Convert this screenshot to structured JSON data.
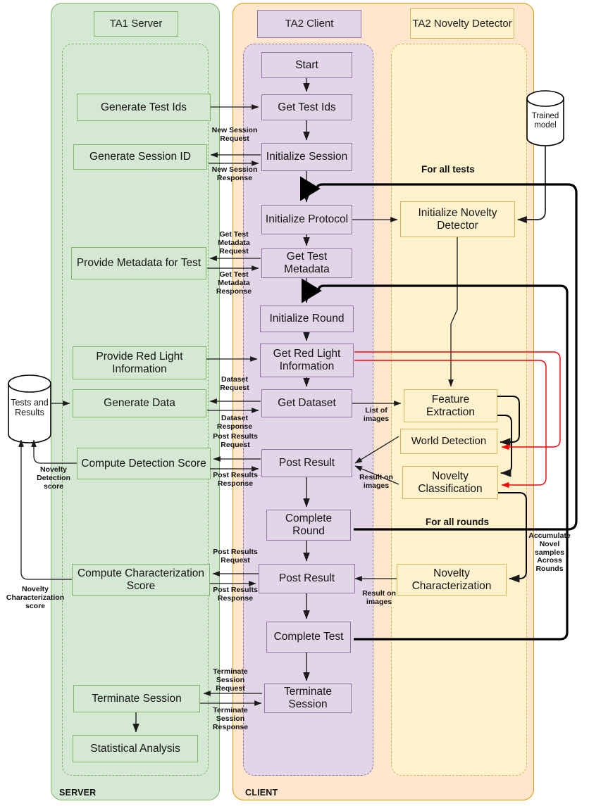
{
  "lanes": [
    {
      "id": "server",
      "title": "TA1 Server",
      "footer": "SERVER",
      "fill": "#d5e8d4",
      "stroke": "#82b366",
      "inner_stroke": "#82b366"
    },
    {
      "id": "client",
      "title": "TA2 Client",
      "footer": "CLIENT",
      "fill": "#ffe6cc",
      "stroke": "#d79b00",
      "inner_stroke": "#9673a6",
      "inner_fill": "#e1d5e7"
    },
    {
      "id": "detector",
      "title": "TA2 Novelty Detector",
      "footer": "",
      "fill": "#ffe6cc",
      "stroke": "#d79b00",
      "inner_stroke": "#d6b656",
      "inner_fill": "#fff2cc"
    }
  ],
  "server_nodes": [
    {
      "id": "generate-test-ids",
      "label": "Generate Test Ids"
    },
    {
      "id": "generate-session-id",
      "label": "Generate Session ID"
    },
    {
      "id": "provide-metadata-for-test",
      "label": "Provide Metadata for Test"
    },
    {
      "id": "provide-red-light-information",
      "label": "Provide Red Light Information"
    },
    {
      "id": "generate-data",
      "label": "Generate Data"
    },
    {
      "id": "compute-detection-score",
      "label": "Compute Detection Score"
    },
    {
      "id": "compute-characterization-score",
      "label": "Compute Characterization Score"
    },
    {
      "id": "terminate-session",
      "label": "Terminate Session"
    },
    {
      "id": "statistical-analysis",
      "label": "Statistical Analysis"
    }
  ],
  "client_nodes": [
    {
      "id": "start",
      "label": "Start"
    },
    {
      "id": "get-test-ids",
      "label": "Get Test Ids"
    },
    {
      "id": "initialize-session",
      "label": "Initialize Session"
    },
    {
      "id": "initialize-protocol",
      "label": "Initialize Protocol"
    },
    {
      "id": "get-test-metadata",
      "label": "Get Test Metadata"
    },
    {
      "id": "initialize-round",
      "label": "Initialize Round"
    },
    {
      "id": "get-red-light-information",
      "label": "Get Red Light Information"
    },
    {
      "id": "get-dataset",
      "label": "Get Dataset"
    },
    {
      "id": "post-result-detection",
      "label": "Post Result"
    },
    {
      "id": "complete-round",
      "label": "Complete Round"
    },
    {
      "id": "post-result-characterization",
      "label": "Post Result"
    },
    {
      "id": "complete-test",
      "label": "Complete Test"
    },
    {
      "id": "terminate-session-client",
      "label": "Terminate Session"
    }
  ],
  "detector_nodes": [
    {
      "id": "initialize-novelty-detector",
      "label": "Initialize Novelty Detector"
    },
    {
      "id": "feature-extraction",
      "label": "Feature Extraction"
    },
    {
      "id": "world-detection",
      "label": "World Detection"
    },
    {
      "id": "novelty-classification",
      "label": "Novelty Classification"
    },
    {
      "id": "novelty-characterization",
      "label": "Novelty Characterization"
    }
  ],
  "datastores": [
    {
      "id": "tests-and-results",
      "label": "Tests and Results"
    },
    {
      "id": "trained-model",
      "label": "Trained model"
    }
  ],
  "edge_labels": [
    {
      "id": "new-session-request",
      "text": "New Session Request"
    },
    {
      "id": "new-session-response",
      "text": "New Session Response"
    },
    {
      "id": "get-test-metadata-request",
      "text": "Get Test Metadata Request"
    },
    {
      "id": "get-test-metadata-response",
      "text": "Get Test Metadata Response"
    },
    {
      "id": "dataset-request",
      "text": "Dataset Request"
    },
    {
      "id": "dataset-response",
      "text": "Dataset Response"
    },
    {
      "id": "post-results-request-1",
      "text": "Post Results Request"
    },
    {
      "id": "post-results-response-1",
      "text": "Post Results Response"
    },
    {
      "id": "post-results-request-2",
      "text": "Post Results Request"
    },
    {
      "id": "post-results-response-2",
      "text": "Post Results Response"
    },
    {
      "id": "terminate-session-request",
      "text": "Terminate Session Request"
    },
    {
      "id": "terminate-session-response",
      "text": "Terminate Session Response"
    },
    {
      "id": "list-of-images",
      "text": "List of images"
    },
    {
      "id": "result-on-images-1",
      "text": "Result on images"
    },
    {
      "id": "result-on-images-2",
      "text": "Result on images"
    },
    {
      "id": "novelty-detection-score",
      "text": "Novelty Detection score"
    },
    {
      "id": "novelty-characterization-score",
      "text": "Novelty Characterization score"
    },
    {
      "id": "accumulate-novel-samples",
      "text": "Accumulate Novel samples Across Rounds"
    }
  ],
  "loop_labels": [
    {
      "id": "for-all-tests",
      "text": "For all tests"
    },
    {
      "id": "for-all-rounds",
      "text": "For all rounds"
    }
  ],
  "colors": {
    "server_fill": "#d5e8d4",
    "server_stroke": "#82b366",
    "client_fill": "#ffe6cc",
    "client_stroke": "#d79b00",
    "client_inner_fill": "#e1d5e7",
    "client_inner_stroke": "#9673a6",
    "detector_inner_fill": "#fff2cc",
    "detector_inner_stroke": "#d6b656",
    "edge": "#1a1a1a",
    "red_edge": "#ff0000",
    "loop": "#000000"
  }
}
